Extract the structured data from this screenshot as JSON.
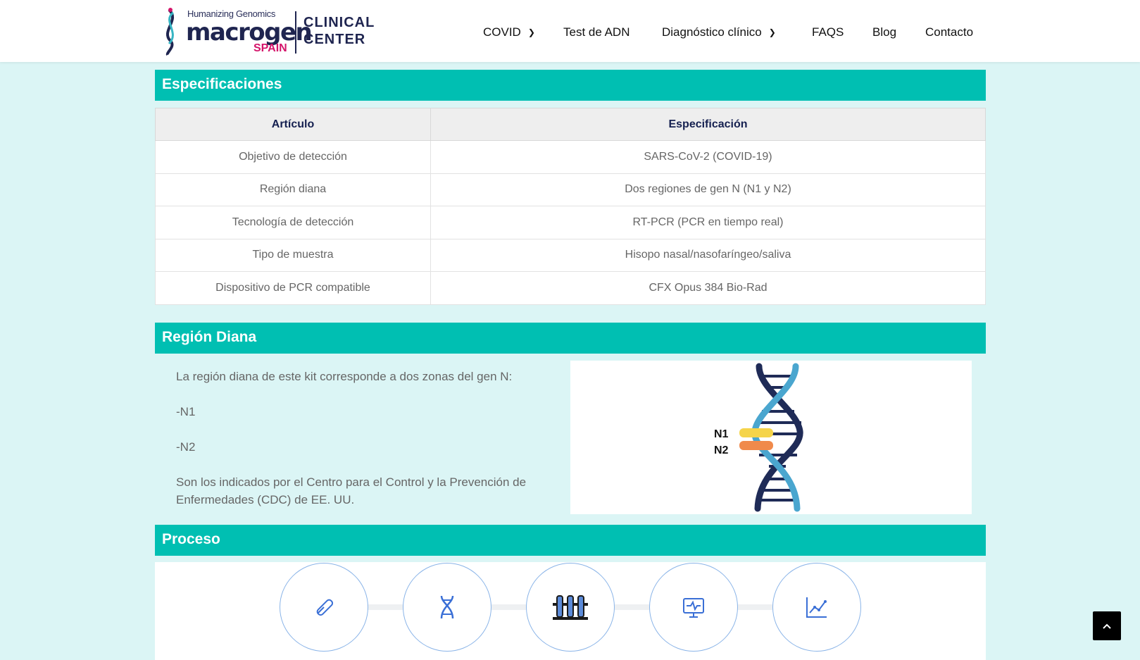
{
  "header": {
    "logo_tagline": "Humanizing Genomics",
    "logo_word": "macrogen",
    "logo_country": "SPAIN",
    "logo_clinical_line1": "CLINICAL",
    "logo_clinical_line2": "CENTER",
    "nav": [
      {
        "label": "COVID",
        "dropdown": true
      },
      {
        "label": "Test de ADN",
        "dropdown": false
      },
      {
        "label": "Diagnóstico clínico",
        "dropdown": true
      },
      {
        "label": "FAQS",
        "dropdown": false
      },
      {
        "label": "Blog",
        "dropdown": false
      },
      {
        "label": "Contacto",
        "dropdown": false
      }
    ]
  },
  "specs": {
    "title": "Especificaciones",
    "headers": [
      "Artículo",
      "Especificación"
    ],
    "rows": [
      [
        "Objetivo de detección",
        "SARS-CoV-2 (COVID-19)"
      ],
      [
        "Región diana",
        "Dos regiones de gen N (N1 y N2)"
      ],
      [
        "Tecnología de detección",
        "RT-PCR (PCR en tiempo real)"
      ],
      [
        "Tipo de muestra",
        "Hisopo nasal/nasofaríngeo/saliva"
      ],
      [
        "Dispositivo de PCR compatible",
        "CFX Opus 384 Bio-Rad"
      ]
    ]
  },
  "region": {
    "title": "Región Diana",
    "intro": "La región diana de este kit corresponde a dos zonas del gen N:",
    "items": [
      "-N1",
      "-N2"
    ],
    "note": "Son los indicados por el Centro para el Control y la Prevención de Enfermedades (CDC) de EE. UU.",
    "dna_labels": [
      "N1",
      "N2"
    ],
    "colors": {
      "strand_dark": "#1f2b57",
      "strand_light": "#4aa6cf",
      "n1": "#f5d44a",
      "n2": "#f08a4b"
    }
  },
  "process": {
    "title": "Proceso",
    "steps": [
      "swab-icon",
      "dna-icon",
      "test-tubes-icon",
      "monitor-icon",
      "chart-icon"
    ]
  },
  "colors": {
    "accent": "#00bfb2",
    "background": "#dbf5f5",
    "navy": "#152050"
  }
}
